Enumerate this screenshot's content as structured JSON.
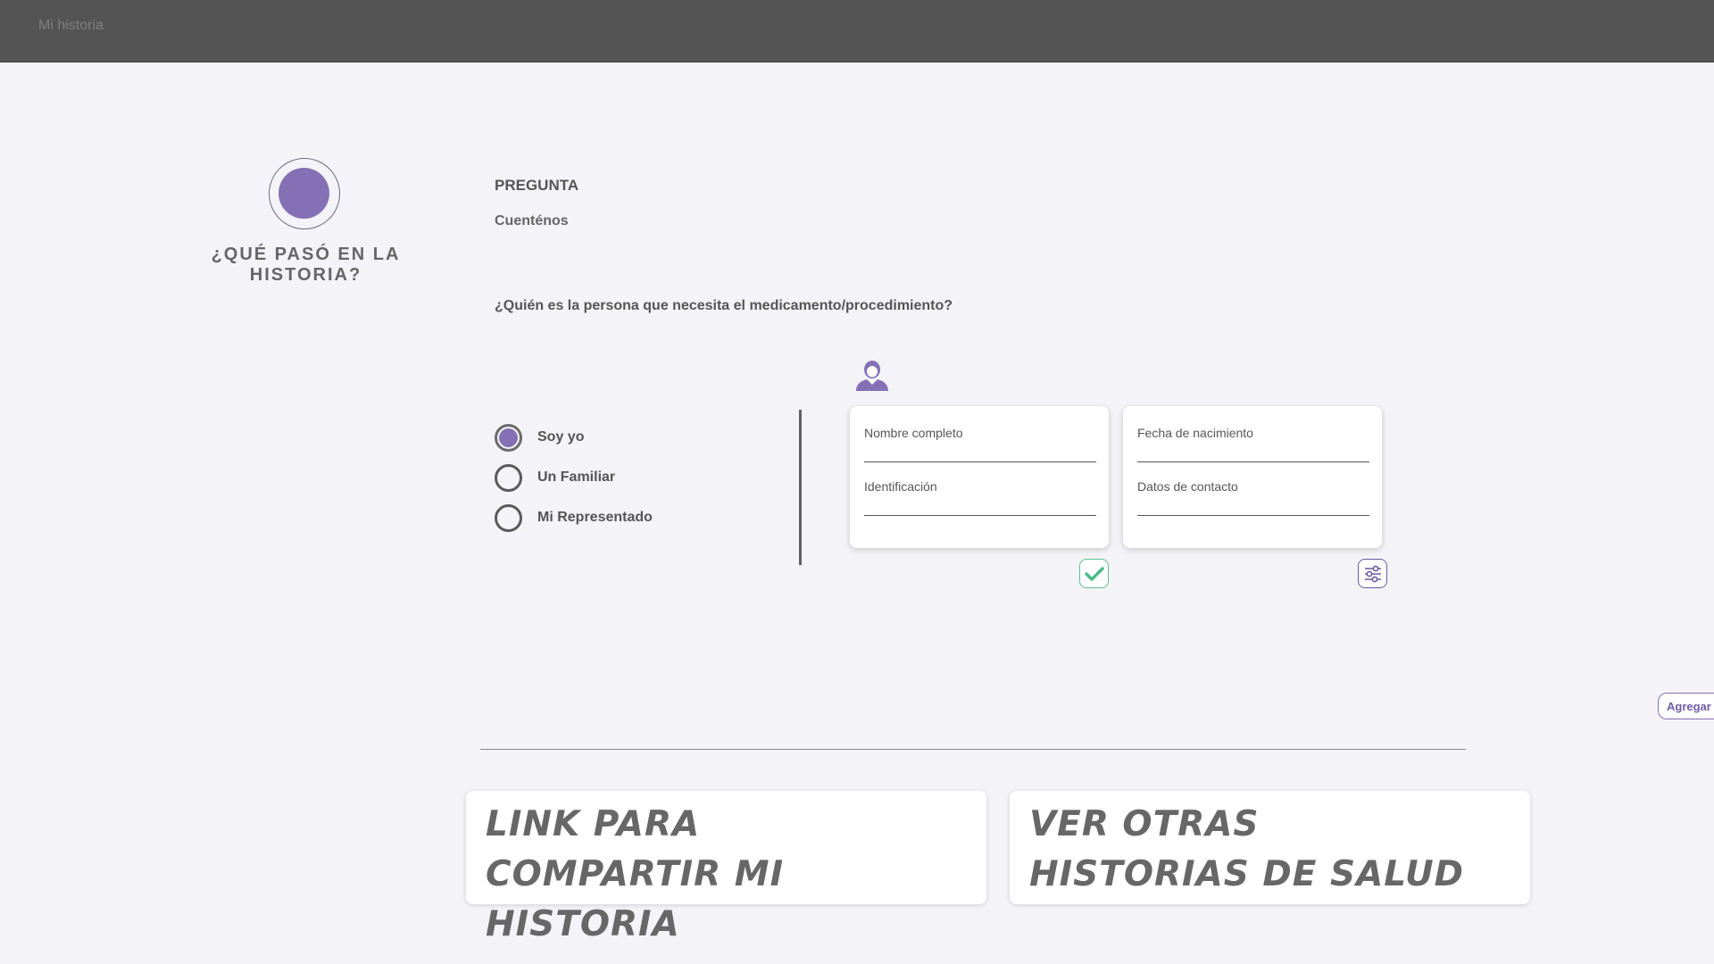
{
  "header": {
    "brand": "Mi historia"
  },
  "step": {
    "title": "¿QUÉ PASÓ EN LA HISTORIA?"
  },
  "question": {
    "label": "PREGUNTA",
    "subtitle": "Cuenténos",
    "text": "¿Quién es la persona que necesita el medicamento/procedimiento?"
  },
  "options": [
    {
      "label": "Soy yo",
      "selected": true
    },
    {
      "label": "Un Familiar",
      "selected": false
    },
    {
      "label": "Mi Representado",
      "selected": false
    }
  ],
  "form": {
    "left_card": {
      "name_placeholder": "Nombre completo",
      "id_placeholder": "Identificación"
    },
    "right_card": {
      "birth_placeholder": "Fecha de nacimiento",
      "contact_placeholder": "Datos de contacto"
    }
  },
  "actions": {
    "add_label": "Agregar r"
  },
  "cards": {
    "share": {
      "line1": "LINK PARA",
      "line2": "COMPARTIR MI HISTORIA"
    },
    "other": {
      "line1": "VER OTRAS",
      "line2": "HISTORIAS DE SALUD"
    }
  },
  "colors": {
    "accent": "#8570b5",
    "topbar": "#545454",
    "check": "#5fbf8f",
    "background": "#f4f3f7"
  }
}
